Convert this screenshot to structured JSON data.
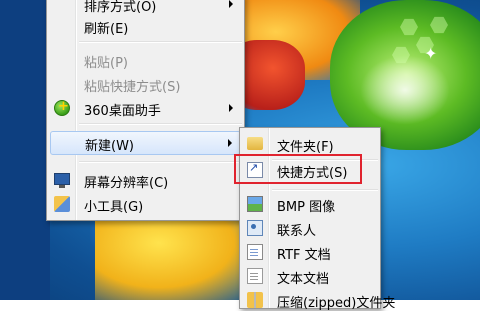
{
  "main_menu": {
    "items": [
      {
        "label": "排序方式(O)",
        "has_submenu": true
      },
      {
        "label": "刷新(E)"
      },
      {
        "label": "粘贴(P)",
        "disabled": true
      },
      {
        "label": "粘贴快捷方式(S)",
        "disabled": true
      },
      {
        "label": "360桌面助手",
        "icon": "360-assistant-icon",
        "has_submenu": true
      },
      {
        "label": "新建(W)",
        "has_submenu": true,
        "highlighted": true
      },
      {
        "label": "屏幕分辨率(C)",
        "icon": "monitor-icon"
      },
      {
        "label": "小工具(G)",
        "icon": "gadget-icon"
      }
    ]
  },
  "new_submenu": {
    "items": [
      {
        "label": "文件夹(F)",
        "icon": "folder-icon"
      },
      {
        "label": "快捷方式(S)",
        "icon": "shortcut-icon",
        "annotated": true
      },
      {
        "label": "BMP 图像",
        "icon": "bmp-image-icon"
      },
      {
        "label": "联系人",
        "icon": "contact-icon"
      },
      {
        "label": "RTF 文档",
        "icon": "rtf-document-icon"
      },
      {
        "label": "文本文档",
        "icon": "text-document-icon"
      },
      {
        "label": "压缩(zipped)文件夹",
        "icon": "zip-folder-icon"
      }
    ]
  },
  "colors": {
    "menu_background": "#f0f0f0",
    "hover_border": "#a8c8f1",
    "annotation_red": "#e0232e",
    "disabled_text": "#8d8d8d"
  }
}
